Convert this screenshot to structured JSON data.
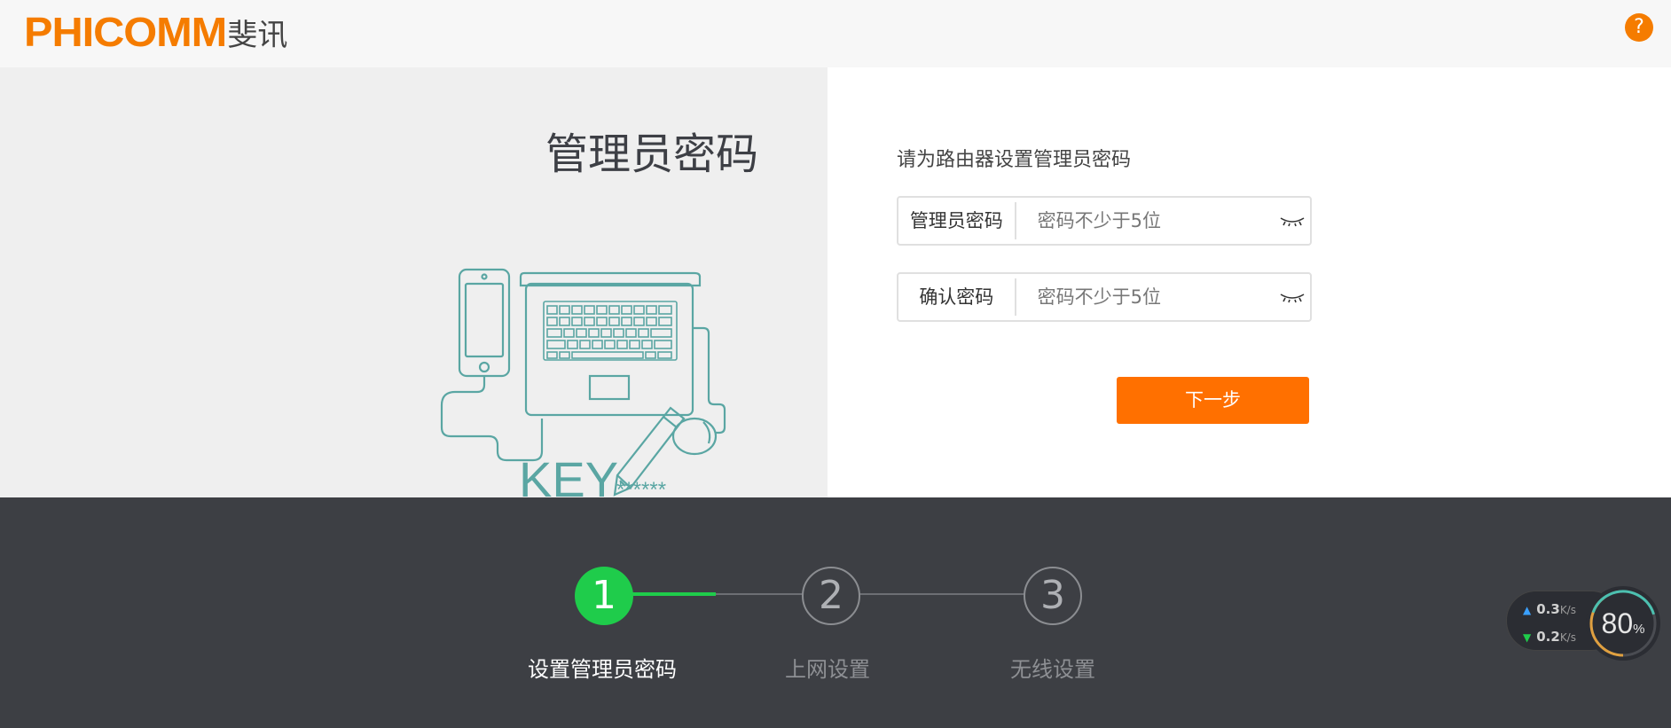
{
  "header": {
    "logo_en": "PHICOMM",
    "logo_cn": "斐讯",
    "help_icon": "?"
  },
  "left": {
    "title": "管理员密码",
    "illustration_text": "KEY",
    "illustration_mask": "******"
  },
  "form": {
    "description": "请为路由器设置管理员密码",
    "admin_password": {
      "label": "管理员密码",
      "placeholder": "密码不少于5位",
      "value": ""
    },
    "confirm_password": {
      "label": "确认密码",
      "placeholder": "密码不少于5位",
      "value": ""
    },
    "next_button": "下一步"
  },
  "steps": [
    {
      "number": "1",
      "label": "设置管理员密码",
      "state": "active"
    },
    {
      "number": "2",
      "label": "上网设置",
      "state": "inactive"
    },
    {
      "number": "3",
      "label": "无线设置",
      "state": "inactive"
    }
  ],
  "speed_widget": {
    "upload_value": "0.3",
    "upload_unit": "K/s",
    "download_value": "0.2",
    "download_unit": "K/s",
    "gauge_value": "80",
    "gauge_unit": "%"
  },
  "colors": {
    "brand_orange": "#ff7000",
    "step_active": "#1fcc4b",
    "footer_bg": "#3d3f44",
    "illustration": "#5aa6a3"
  }
}
